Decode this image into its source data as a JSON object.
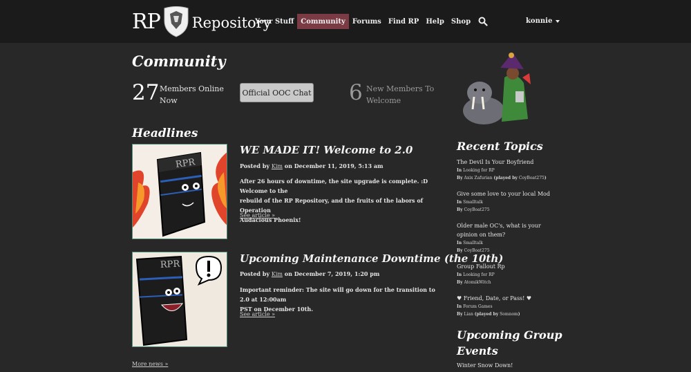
{
  "nav": {
    "logo_left": "RP",
    "logo_right": "Repository",
    "links": [
      {
        "label": "Your Stuff"
      },
      {
        "label": "Community"
      },
      {
        "label": "Forums"
      },
      {
        "label": "Find RP"
      },
      {
        "label": "Help"
      },
      {
        "label": "Shop"
      }
    ],
    "active_link": "Community",
    "search_icon": "search-icon",
    "username": "konnie"
  },
  "page": {
    "title": "Community"
  },
  "stats": {
    "online_count": "27",
    "online_label_1": "Members Online",
    "online_label_2": "Now",
    "ooc_button": "Official OOC Chat",
    "new_count": "6",
    "new_label_1": "New Members To",
    "new_label_2": "Welcome"
  },
  "headlines": {
    "title": "Headlines",
    "articles": [
      {
        "title": "WE MADE IT! Welcome to 2.0",
        "posted_by": "Posted by",
        "author": "Kim",
        "date": "on December 11, 2019, 5:13 am",
        "body_1": "After 26 hours of downtime, the site upgrade is complete. :D Welcome to the",
        "body_2": "rebuild of the RP Repository, and the fruits of the labors of Operation",
        "body_3": "Audacious Phoenix!",
        "link": "See article »",
        "image_label": "RPR"
      },
      {
        "title": "Upcoming Maintenance Downtime (the 10th)",
        "posted_by": "Posted by",
        "author": "Kim",
        "date": "on December 7, 2019, 1:20 pm",
        "body_1": "Important reminder: The site will go down for the transition to 2.0 at 12:00am",
        "body_2": "PST on December 10th.",
        "link": "See article »",
        "image_label": "RPR"
      }
    ],
    "more_link": "More news »"
  },
  "recent_topics": {
    "title": "Recent Topics",
    "items": [
      {
        "title": "The Devil Is Your Boyfriend",
        "in_word": "In",
        "forum": "Looking for RP",
        "by_word": "By",
        "by": "Axix Zafurian",
        "played_by": "(played by",
        "player": "CoyBoat275",
        "close": ")"
      },
      {
        "title": "Give some love to your local Mod",
        "in_word": "In",
        "forum": "Smalltalk",
        "by_word": "By",
        "by": "CoyBoat275"
      },
      {
        "title_1": "Older male OC's, what is your",
        "title_2": "opinion on them?",
        "in_word": "In",
        "forum": "Smalltalk",
        "by_word": "By",
        "by": "CoyBoat275"
      },
      {
        "title": "Group Fallout Rp",
        "in_word": "In",
        "forum": "Looking for RP",
        "by_word": "By",
        "by": "AtomikWitch"
      },
      {
        "title": "♥ Friend, Date, or Pass! ♥",
        "in_word": "In",
        "forum": "Forum Games",
        "by_word": "By",
        "by": "Lian",
        "played_by": "(played by",
        "player": "Somnom",
        "close": ")"
      }
    ]
  },
  "events": {
    "title_1": "Upcoming Group",
    "title_2": "Events",
    "item": "Winter Snow Down!"
  },
  "colors": {
    "background": "#282828",
    "navbar": "#1b1b1b",
    "active_nav": "#7a3b45",
    "image_border": "#4d8f7a"
  }
}
